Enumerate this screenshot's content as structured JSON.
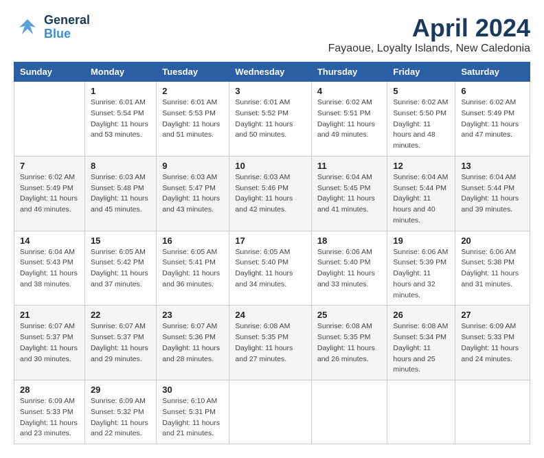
{
  "header": {
    "logo_general": "General",
    "logo_blue": "Blue",
    "title": "April 2024",
    "subtitle": "Fayaoue, Loyalty Islands, New Caledonia"
  },
  "days_of_week": [
    "Sunday",
    "Monday",
    "Tuesday",
    "Wednesday",
    "Thursday",
    "Friday",
    "Saturday"
  ],
  "weeks": [
    [
      {
        "day": "",
        "sunrise": "",
        "sunset": "",
        "daylight": ""
      },
      {
        "day": "1",
        "sunrise": "Sunrise: 6:01 AM",
        "sunset": "Sunset: 5:54 PM",
        "daylight": "Daylight: 11 hours and 53 minutes."
      },
      {
        "day": "2",
        "sunrise": "Sunrise: 6:01 AM",
        "sunset": "Sunset: 5:53 PM",
        "daylight": "Daylight: 11 hours and 51 minutes."
      },
      {
        "day": "3",
        "sunrise": "Sunrise: 6:01 AM",
        "sunset": "Sunset: 5:52 PM",
        "daylight": "Daylight: 11 hours and 50 minutes."
      },
      {
        "day": "4",
        "sunrise": "Sunrise: 6:02 AM",
        "sunset": "Sunset: 5:51 PM",
        "daylight": "Daylight: 11 hours and 49 minutes."
      },
      {
        "day": "5",
        "sunrise": "Sunrise: 6:02 AM",
        "sunset": "Sunset: 5:50 PM",
        "daylight": "Daylight: 11 hours and 48 minutes."
      },
      {
        "day": "6",
        "sunrise": "Sunrise: 6:02 AM",
        "sunset": "Sunset: 5:49 PM",
        "daylight": "Daylight: 11 hours and 47 minutes."
      }
    ],
    [
      {
        "day": "7",
        "sunrise": "Sunrise: 6:02 AM",
        "sunset": "Sunset: 5:49 PM",
        "daylight": "Daylight: 11 hours and 46 minutes."
      },
      {
        "day": "8",
        "sunrise": "Sunrise: 6:03 AM",
        "sunset": "Sunset: 5:48 PM",
        "daylight": "Daylight: 11 hours and 45 minutes."
      },
      {
        "day": "9",
        "sunrise": "Sunrise: 6:03 AM",
        "sunset": "Sunset: 5:47 PM",
        "daylight": "Daylight: 11 hours and 43 minutes."
      },
      {
        "day": "10",
        "sunrise": "Sunrise: 6:03 AM",
        "sunset": "Sunset: 5:46 PM",
        "daylight": "Daylight: 11 hours and 42 minutes."
      },
      {
        "day": "11",
        "sunrise": "Sunrise: 6:04 AM",
        "sunset": "Sunset: 5:45 PM",
        "daylight": "Daylight: 11 hours and 41 minutes."
      },
      {
        "day": "12",
        "sunrise": "Sunrise: 6:04 AM",
        "sunset": "Sunset: 5:44 PM",
        "daylight": "Daylight: 11 hours and 40 minutes."
      },
      {
        "day": "13",
        "sunrise": "Sunrise: 6:04 AM",
        "sunset": "Sunset: 5:44 PM",
        "daylight": "Daylight: 11 hours and 39 minutes."
      }
    ],
    [
      {
        "day": "14",
        "sunrise": "Sunrise: 6:04 AM",
        "sunset": "Sunset: 5:43 PM",
        "daylight": "Daylight: 11 hours and 38 minutes."
      },
      {
        "day": "15",
        "sunrise": "Sunrise: 6:05 AM",
        "sunset": "Sunset: 5:42 PM",
        "daylight": "Daylight: 11 hours and 37 minutes."
      },
      {
        "day": "16",
        "sunrise": "Sunrise: 6:05 AM",
        "sunset": "Sunset: 5:41 PM",
        "daylight": "Daylight: 11 hours and 36 minutes."
      },
      {
        "day": "17",
        "sunrise": "Sunrise: 6:05 AM",
        "sunset": "Sunset: 5:40 PM",
        "daylight": "Daylight: 11 hours and 34 minutes."
      },
      {
        "day": "18",
        "sunrise": "Sunrise: 6:06 AM",
        "sunset": "Sunset: 5:40 PM",
        "daylight": "Daylight: 11 hours and 33 minutes."
      },
      {
        "day": "19",
        "sunrise": "Sunrise: 6:06 AM",
        "sunset": "Sunset: 5:39 PM",
        "daylight": "Daylight: 11 hours and 32 minutes."
      },
      {
        "day": "20",
        "sunrise": "Sunrise: 6:06 AM",
        "sunset": "Sunset: 5:38 PM",
        "daylight": "Daylight: 11 hours and 31 minutes."
      }
    ],
    [
      {
        "day": "21",
        "sunrise": "Sunrise: 6:07 AM",
        "sunset": "Sunset: 5:37 PM",
        "daylight": "Daylight: 11 hours and 30 minutes."
      },
      {
        "day": "22",
        "sunrise": "Sunrise: 6:07 AM",
        "sunset": "Sunset: 5:37 PM",
        "daylight": "Daylight: 11 hours and 29 minutes."
      },
      {
        "day": "23",
        "sunrise": "Sunrise: 6:07 AM",
        "sunset": "Sunset: 5:36 PM",
        "daylight": "Daylight: 11 hours and 28 minutes."
      },
      {
        "day": "24",
        "sunrise": "Sunrise: 6:08 AM",
        "sunset": "Sunset: 5:35 PM",
        "daylight": "Daylight: 11 hours and 27 minutes."
      },
      {
        "day": "25",
        "sunrise": "Sunrise: 6:08 AM",
        "sunset": "Sunset: 5:35 PM",
        "daylight": "Daylight: 11 hours and 26 minutes."
      },
      {
        "day": "26",
        "sunrise": "Sunrise: 6:08 AM",
        "sunset": "Sunset: 5:34 PM",
        "daylight": "Daylight: 11 hours and 25 minutes."
      },
      {
        "day": "27",
        "sunrise": "Sunrise: 6:09 AM",
        "sunset": "Sunset: 5:33 PM",
        "daylight": "Daylight: 11 hours and 24 minutes."
      }
    ],
    [
      {
        "day": "28",
        "sunrise": "Sunrise: 6:09 AM",
        "sunset": "Sunset: 5:33 PM",
        "daylight": "Daylight: 11 hours and 23 minutes."
      },
      {
        "day": "29",
        "sunrise": "Sunrise: 6:09 AM",
        "sunset": "Sunset: 5:32 PM",
        "daylight": "Daylight: 11 hours and 22 minutes."
      },
      {
        "day": "30",
        "sunrise": "Sunrise: 6:10 AM",
        "sunset": "Sunset: 5:31 PM",
        "daylight": "Daylight: 11 hours and 21 minutes."
      },
      {
        "day": "",
        "sunrise": "",
        "sunset": "",
        "daylight": ""
      },
      {
        "day": "",
        "sunrise": "",
        "sunset": "",
        "daylight": ""
      },
      {
        "day": "",
        "sunrise": "",
        "sunset": "",
        "daylight": ""
      },
      {
        "day": "",
        "sunrise": "",
        "sunset": "",
        "daylight": ""
      }
    ]
  ]
}
